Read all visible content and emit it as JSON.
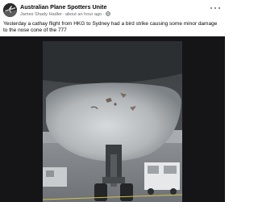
{
  "post": {
    "group_name": "Australian Plane Spotters Unite",
    "author": "James Shady Hadler",
    "separator": "·",
    "timestamp": "about an hour ago",
    "caption": "Yesterday a cathay flight from HKG to Sydney had a bird strike causing some minor damage to the nose cone of the 777"
  },
  "icons": {
    "avatar": "group-avatar",
    "privacy": "globe-icon",
    "menu": "more-options-icon"
  },
  "colors": {
    "text_primary": "#050505",
    "text_secondary": "#65676b",
    "media_background": "#151517"
  }
}
